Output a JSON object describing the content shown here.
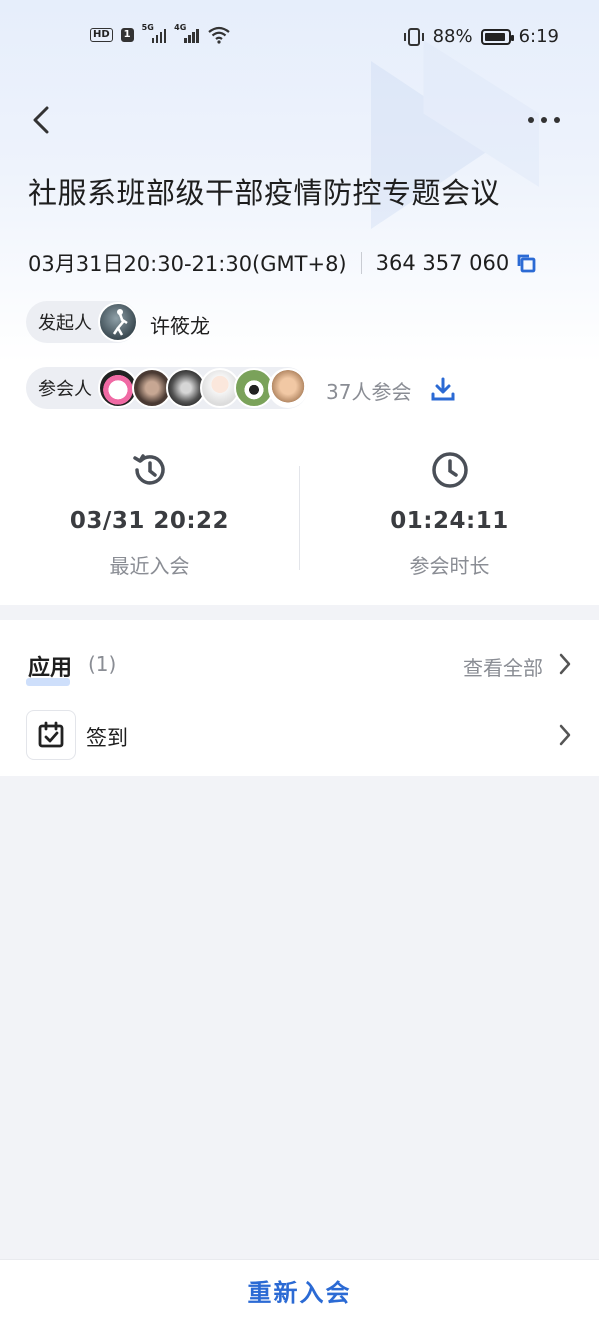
{
  "status_bar": {
    "hd": "HD",
    "sim": "1",
    "net1": "5G",
    "net2": "4G",
    "battery": "88%",
    "time": "6:19"
  },
  "meeting": {
    "title": "社服系班部级干部疫情防控专题会议",
    "time_range": "03月31日20:30-21:30(GMT+8)",
    "meeting_id": "364 357 060"
  },
  "initiator": {
    "label": "发起人",
    "name": "许筱龙"
  },
  "participants": {
    "label": "参会人",
    "count_text": "37人参会"
  },
  "stats": {
    "last_join": {
      "value": "03/31 20:22",
      "label": "最近入会"
    },
    "duration": {
      "value": "01:24:11",
      "label": "参会时长"
    }
  },
  "apps": {
    "title": "应用",
    "count": "(1)",
    "view_all": "查看全部",
    "items": [
      {
        "label": "签到"
      }
    ]
  },
  "footer": {
    "rejoin": "重新入会"
  },
  "colors": {
    "accent": "#2b6ad4",
    "muted": "#8a8d94"
  }
}
